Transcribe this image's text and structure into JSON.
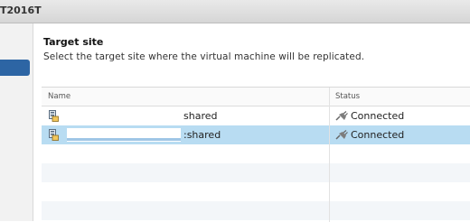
{
  "window": {
    "title": "T2016T"
  },
  "wizard": {
    "heading": "Target site",
    "subtitle": "Select the target site where the virtual machine will be replicated."
  },
  "grid": {
    "columns": {
      "name": "Name",
      "status": "Status"
    },
    "rows": [
      {
        "name": "shared",
        "status": "Connected",
        "selected": false
      },
      {
        "name": ":shared",
        "status": "Connected",
        "selected": true
      }
    ]
  },
  "icons": {
    "site": "site-server-icon",
    "status": "plug-connected-icon"
  }
}
